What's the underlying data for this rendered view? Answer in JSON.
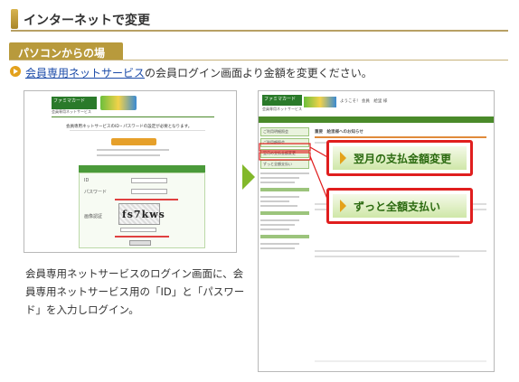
{
  "header": {
    "title": "インターネットで変更"
  },
  "section": {
    "tab_label": "パソコンからの場合"
  },
  "intro": {
    "link_text": "会員専用ネットサービス",
    "rest_text": "の会員ログイン画面より金額を変更ください。"
  },
  "login_screenshot": {
    "logo": "ファミマカード",
    "logo_sub": "会員専用ネットサービス",
    "notice": "会員専用ネットサービスのID・パスワードの設定が必要となります。",
    "field_id": "ID",
    "field_password": "パスワード",
    "field_captcha": "画像認証",
    "captcha_text": "fs7kws"
  },
  "caption": {
    "text": "会員専用ネットサービスのログイン画面に、会員専用ネットサービス用の「ID」と「パスワード」を入力しログイン。"
  },
  "member_screenshot": {
    "logo": "ファミマカード",
    "logo_sub": "会員専用ネットサービス",
    "greeting": "ようこそ！ 会員　絵里 様",
    "notice_title": "重要　絵里様へのお知らせ",
    "menu": [
      "ご利用明細照会",
      "ご利用額照会",
      "翌月の支払金額変更",
      "ずっと全額支払い"
    ]
  },
  "callouts": {
    "next_month": "翌月の支払金額変更",
    "full_payment": "ずっと全額支払い"
  },
  "colors": {
    "accent_gold": "#b89a3c",
    "link_blue": "#1a4aa8",
    "callout_red": "#e01e1e",
    "callout_green_text": "#2b6a10",
    "arrow_green": "#82b82a"
  }
}
